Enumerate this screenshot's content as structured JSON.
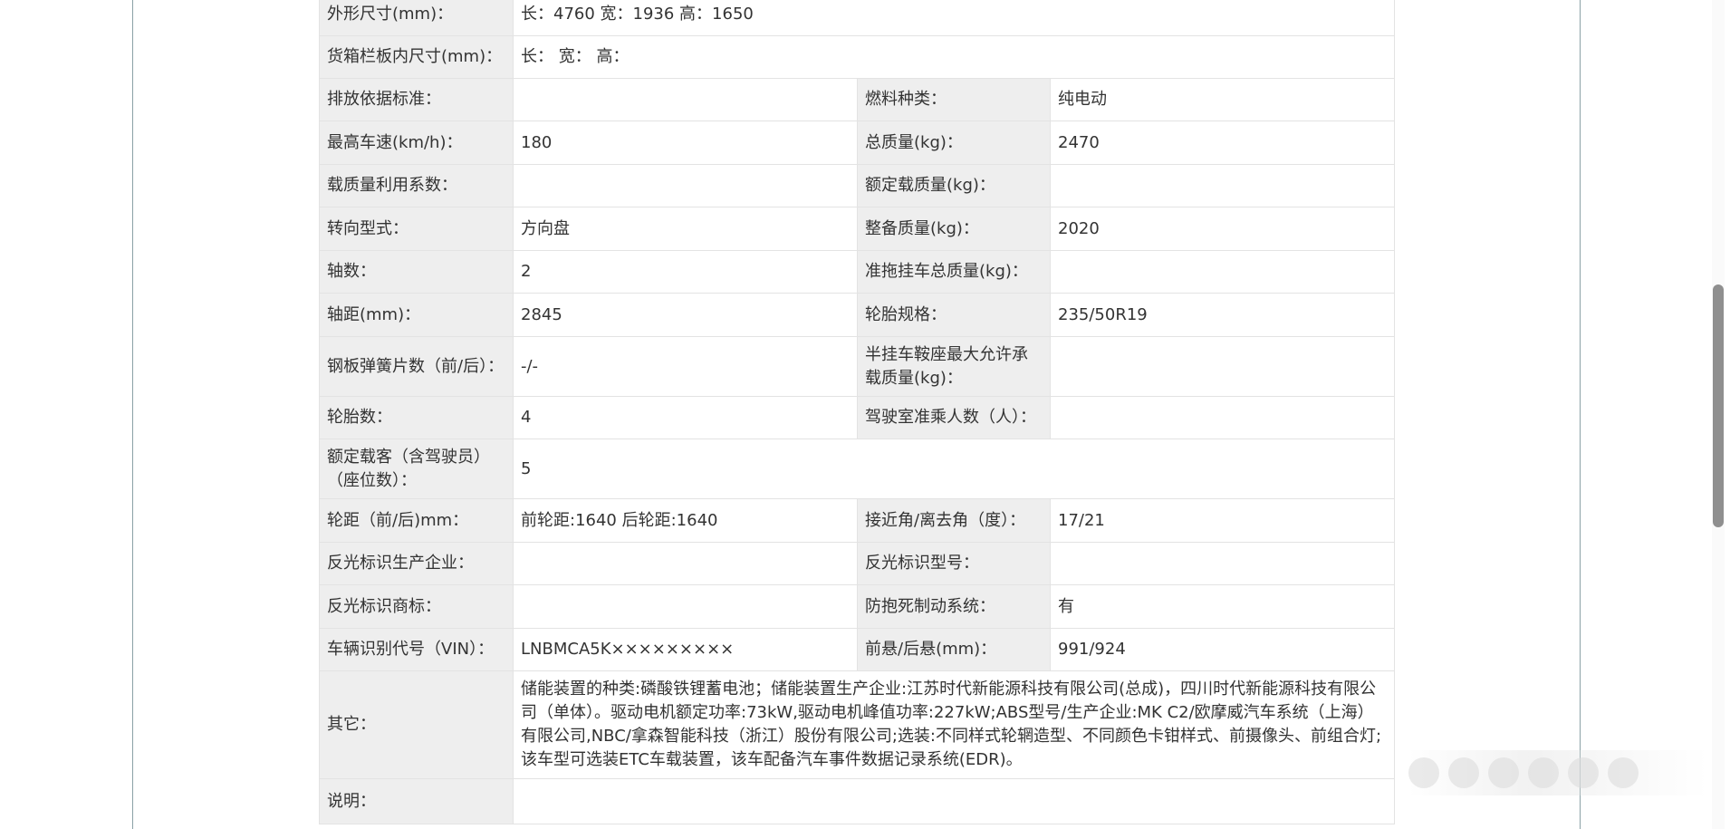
{
  "rows": [
    {
      "cells": [
        {
          "label": "外形尺寸(mm)：",
          "value": "长：4760 宽：1936 高：1650"
        }
      ]
    },
    {
      "cells": [
        {
          "label": "货箱栏板内尺寸(mm)：",
          "value": "长：  宽：  高："
        }
      ]
    },
    {
      "cells": [
        {
          "label": "排放依据标准：",
          "value": ""
        },
        {
          "label": "燃料种类：",
          "value": "纯电动"
        }
      ]
    },
    {
      "cells": [
        {
          "label": "最高车速(km/h)：",
          "value": "180"
        },
        {
          "label": "总质量(kg)：",
          "value": "2470"
        }
      ]
    },
    {
      "cells": [
        {
          "label": "载质量利用系数：",
          "value": ""
        },
        {
          "label": "额定载质量(kg)：",
          "value": ""
        }
      ]
    },
    {
      "cells": [
        {
          "label": "转向型式：",
          "value": "方向盘"
        },
        {
          "label": "整备质量(kg)：",
          "value": "2020"
        }
      ]
    },
    {
      "cells": [
        {
          "label": "轴数：",
          "value": "2"
        },
        {
          "label": "准拖挂车总质量(kg)：",
          "value": ""
        }
      ]
    },
    {
      "cells": [
        {
          "label": "轴距(mm)：",
          "value": "2845"
        },
        {
          "label": "轮胎规格：",
          "value": "235/50R19"
        }
      ]
    },
    {
      "cells": [
        {
          "label": "钢板弹簧片数（前/后）：",
          "value": "-/-"
        },
        {
          "label": "半挂车鞍座最大允许承载质量(kg)：",
          "value": ""
        }
      ]
    },
    {
      "cells": [
        {
          "label": "轮胎数：",
          "value": "4"
        },
        {
          "label": "驾驶室准乘人数（人）：",
          "value": ""
        }
      ]
    },
    {
      "cells": [
        {
          "label": "额定载客（含驾驶员）（座位数）：",
          "value": "5"
        }
      ]
    },
    {
      "cells": [
        {
          "label": "轮距（前/后)mm：",
          "value": "前轮距:1640 后轮距:1640"
        },
        {
          "label": "接近角/离去角（度）：",
          "value": "17/21"
        }
      ]
    },
    {
      "cells": [
        {
          "label": "反光标识生产企业：",
          "value": ""
        },
        {
          "label": "反光标识型号：",
          "value": ""
        }
      ]
    },
    {
      "cells": [
        {
          "label": "反光标识商标：",
          "value": ""
        },
        {
          "label": "防抱死制动系统：",
          "value": "有"
        }
      ]
    },
    {
      "cells": [
        {
          "label": "车辆识别代号（VIN）：",
          "value": "LNBMCA5K×××××××××"
        },
        {
          "label": "前悬/后悬(mm)：",
          "value": "991/924"
        }
      ]
    },
    {
      "cells": [
        {
          "label": "其它：",
          "value": "储能装置的种类:磷酸铁锂蓄电池；储能装置生产企业:江苏时代新能源科技有限公司(总成)，四川时代新能源科技有限公司（单体）。驱动电机额定功率:73kW,驱动电机峰值功率:227kW;ABS型号/生产企业:MK C2/欧摩威汽车系统（上海）有限公司,NBC/拿森智能科技（浙江）股份有限公司;选装:不同样式轮辋造型、不同颜色卡钳样式、前摄像头、前组合灯;该车型可选装ETC车载装置，该车配备汽车事件数据记录系统(EDR)。"
        }
      ]
    },
    {
      "cells": [
        {
          "label": "说明：",
          "value": ""
        }
      ]
    }
  ]
}
